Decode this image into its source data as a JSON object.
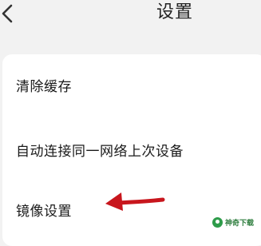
{
  "header": {
    "title": "设置",
    "back_icon": "chevron-left-icon"
  },
  "settings": {
    "items": [
      {
        "label": "清除缓存"
      },
      {
        "label": "自动连接同一网络上次设备"
      },
      {
        "label": "镜像设置"
      }
    ]
  },
  "annotation": {
    "arrow_color": "#c8161d",
    "icon": "red-arrow-icon"
  },
  "watermark": {
    "text": "神奇下载",
    "color": "#2e9c4a"
  },
  "colors": {
    "background": "#f2f2f2",
    "panel": "#ffffff",
    "text": "#1a1a1a"
  }
}
